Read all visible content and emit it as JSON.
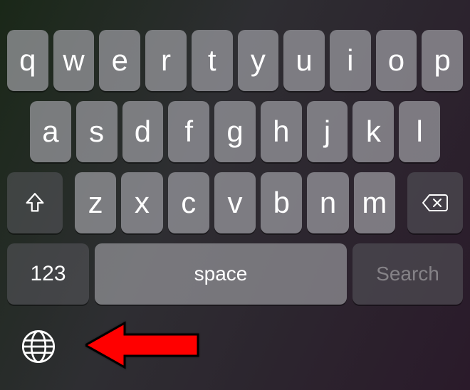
{
  "keyboard": {
    "row1": [
      "q",
      "w",
      "e",
      "r",
      "t",
      "y",
      "u",
      "i",
      "o",
      "p"
    ],
    "row2": [
      "a",
      "s",
      "d",
      "f",
      "g",
      "h",
      "j",
      "k",
      "l"
    ],
    "row3": [
      "z",
      "x",
      "c",
      "v",
      "b",
      "n",
      "m"
    ],
    "numbers_label": "123",
    "space_label": "space",
    "search_label": "Search"
  },
  "annotation": {
    "highlight": "globe-icon",
    "arrow_color": "#ff0000"
  }
}
